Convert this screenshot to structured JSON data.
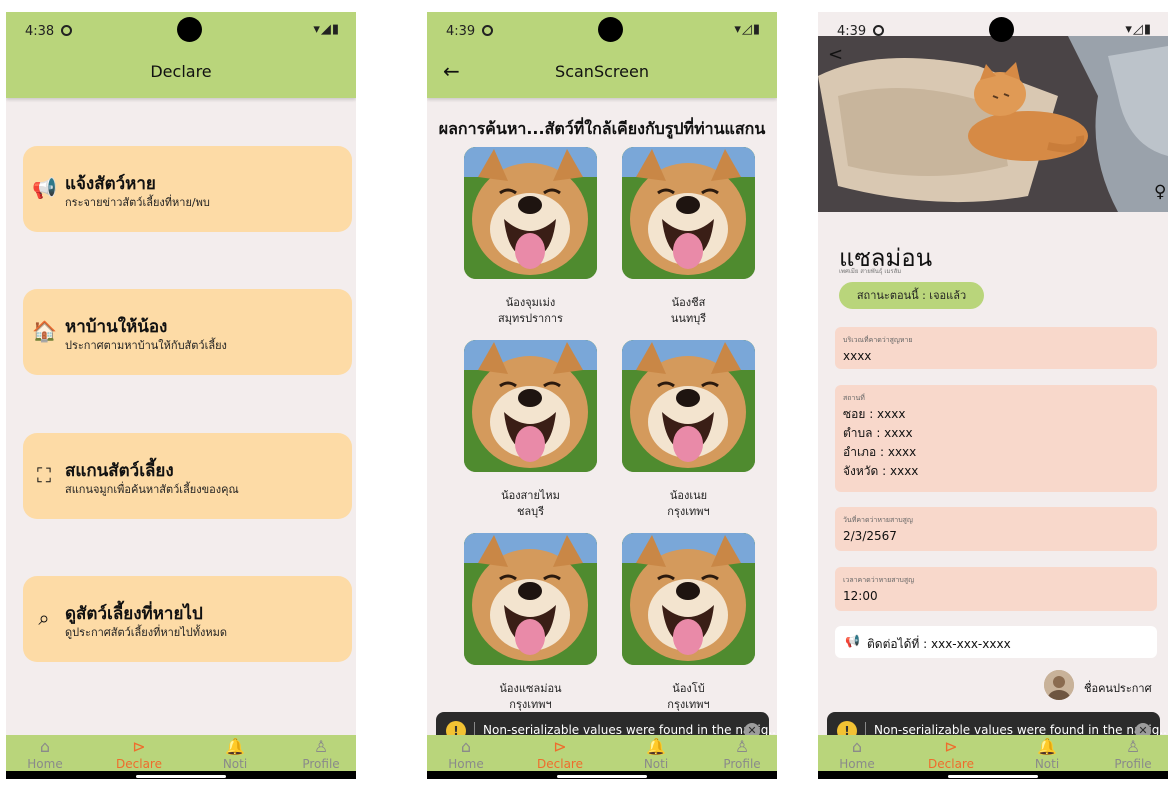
{
  "status_bar": [
    {
      "time": "4:38",
      "icons": "▾◢▮"
    },
    {
      "time": "4:39",
      "icons": "▾◿▮"
    },
    {
      "time": "4:39",
      "icons": "▾◿▮"
    }
  ],
  "screen1": {
    "title": "Declare",
    "menu": [
      {
        "title": "แจ้งสัตว์หาย",
        "subtitle": "กระจายข่าวสัตว์เลี้ยงที่หาย/พบ",
        "icon": "megaphone-icon",
        "glyph": "📢"
      },
      {
        "title": "หาบ้านให้น้อง",
        "subtitle": "ประกาศตามหาบ้านให้กับสัตว์เลี้ยง",
        "icon": "home-icon",
        "glyph": "🏠"
      },
      {
        "title": "สแกนสัตว์เลี้ยง",
        "subtitle": "สแกนจมูกเพื่อค้นหาสัตว์เลี้ยงของคุณ",
        "icon": "scan-icon",
        "glyph": "⛶"
      },
      {
        "title": "ดูสัตว์เลี้ยงที่หายไป",
        "subtitle": "ดูประกาศสัตว์เลี้ยงที่หายไปทั้งหมด",
        "icon": "search-icon",
        "glyph": "⌕"
      }
    ]
  },
  "screen2": {
    "title": "ScanScreen",
    "heading": "ผลการค้นหา...สัตว์ที่ใกล้เคียงกับรูปที่ท่านแสกน",
    "pets": [
      {
        "name": "น้องจุมเม่ง",
        "province": "สมุทรปราการ"
      },
      {
        "name": "น้องชีส",
        "province": "นนทบุรี"
      },
      {
        "name": "น้องสายไหม",
        "province": "ชลบุรี"
      },
      {
        "name": "น้องเนย",
        "province": "กรุงเทพฯ"
      },
      {
        "name": "น้องแซลม่อน",
        "province": "กรุงเทพฯ"
      },
      {
        "name": "น้องโบ้",
        "province": "กรุงเทพฯ"
      }
    ]
  },
  "screen3": {
    "pet_name": "แซลม่อน",
    "pet_sub": "เพศเมีย สายพันธุ์ เมรสัม",
    "status": "สถานะตอนนี้ : เจอแล้ว",
    "gender": "♀",
    "fields": [
      {
        "label": "บริเวณที่คาดว่าสูญหาย",
        "lines": [
          "xxxx"
        ]
      },
      {
        "label": "สถานที่",
        "lines": [
          "ซอย : xxxx",
          "ตำบล : xxxx",
          "อำเภอ : xxxx",
          "จังหวัด : xxxx"
        ]
      },
      {
        "label": "วันที่คาดว่าหายสาบสูญ",
        "lines": [
          "2/3/2567"
        ]
      },
      {
        "label": "เวลาคาดว่าหายสาบสูญ",
        "lines": [
          "12:00"
        ]
      }
    ],
    "contact": "ติดต่อได้ที่ :  xxx-xxx-xxxx",
    "poster_name": "ชื่อคนประกาศ"
  },
  "toast": "Non-serializable values were found in the navig...",
  "nav": [
    {
      "label": "Home",
      "icon": "home-icon",
      "glyph": "⌂"
    },
    {
      "label": "Declare",
      "icon": "declare-icon",
      "glyph": "⊳"
    },
    {
      "label": "Noti",
      "icon": "bell-icon",
      "glyph": "🔔"
    },
    {
      "label": "Profile",
      "icon": "profile-icon",
      "glyph": "♙"
    }
  ],
  "active_nav": "Declare",
  "colors": {
    "header": "#b9d57b",
    "card": "#fddba6",
    "info_box": "#f8d8cb",
    "active": "#ef6c2c",
    "background": "#f3eded"
  }
}
